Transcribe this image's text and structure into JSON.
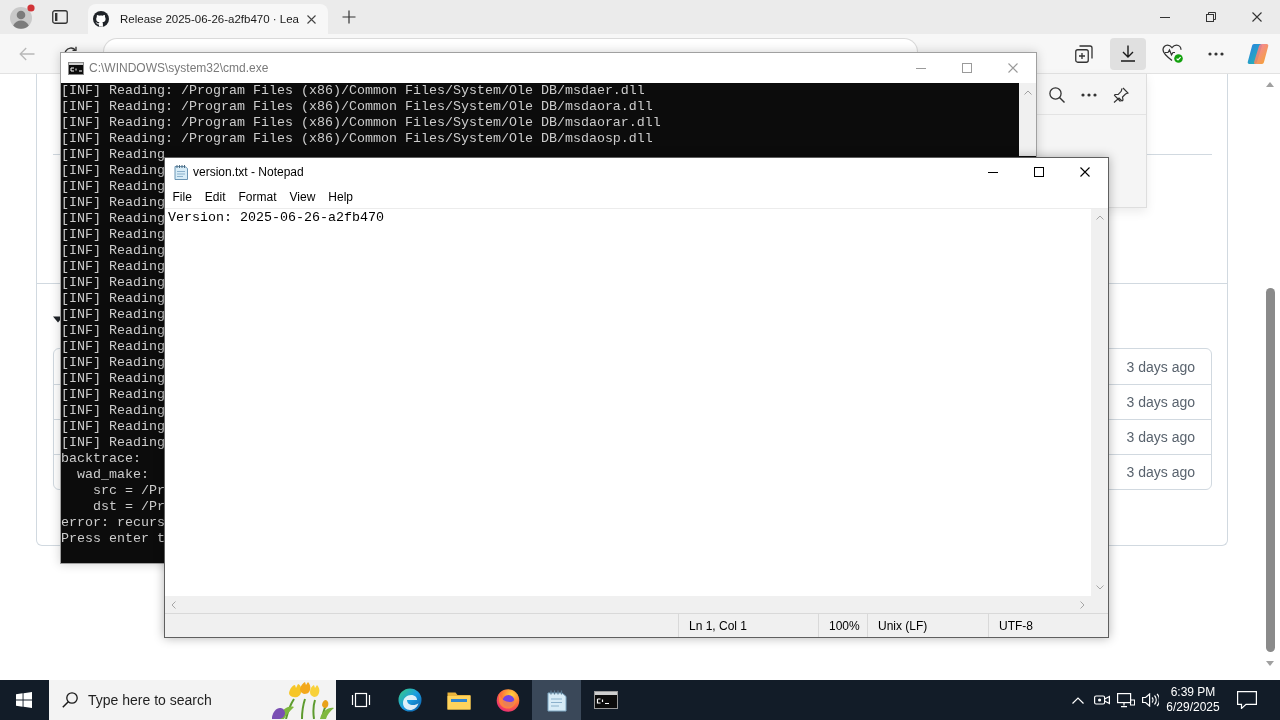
{
  "browser": {
    "tab": {
      "title": "Release 2025-06-26-a2fb470 · Lea",
      "selected": true
    },
    "back_disabled": true,
    "downloads_open": true,
    "page": {
      "assets": {
        "expanded": true,
        "rows": [
          {
            "date": "3 days ago"
          },
          {
            "date": "3 days ago"
          },
          {
            "date": "3 days ago"
          },
          {
            "date": "3 days ago"
          }
        ]
      }
    }
  },
  "cmd_window": {
    "title": "C:\\WINDOWS\\system32\\cmd.exe",
    "active": false,
    "lines": [
      "[INF] Reading: /Program Files (x86)/Common Files/System/Ole DB/msdaer.dll",
      "[INF] Reading: /Program Files (x86)/Common Files/System/Ole DB/msdaora.dll",
      "[INF] Reading: /Program Files (x86)/Common Files/System/Ole DB/msdaorar.dll",
      "[INF] Reading: /Program Files (x86)/Common Files/System/Ole DB/msdaosp.dll",
      "[INF] Reading",
      "[INF] Reading",
      "[INF] Reading",
      "[INF] Reading",
      "[INF] Reading",
      "[INF] Reading",
      "[INF] Reading",
      "[INF] Reading",
      "[INF] Reading",
      "[INF] Reading",
      "[INF] Reading",
      "[INF] Reading",
      "[INF] Reading",
      "[INF] Reading",
      "[INF] Reading",
      "[INF] Reading",
      "[INF] Reading",
      "[INF] Reading",
      "[INF] Reading",
      "backtrace:",
      "  wad_make:",
      "    src = /Pr",
      "    dst = /Pr",
      "error: recurs",
      "Press enter t"
    ]
  },
  "notepad": {
    "title": "version.txt - Notepad",
    "active": true,
    "menu": [
      "File",
      "Edit",
      "Format",
      "View",
      "Help"
    ],
    "text": "Version: 2025-06-26-a2fb470",
    "status": [
      "Ln 1, Col 1",
      "100%",
      "Unix (LF)",
      "UTF-8"
    ]
  },
  "taskbar": {
    "search_placeholder": "Type here to search",
    "apps": [
      {
        "kind": "task_view",
        "selected": false
      },
      {
        "kind": "edge",
        "selected": false
      },
      {
        "kind": "explorer",
        "selected": false
      },
      {
        "kind": "firefox",
        "selected": false
      },
      {
        "kind": "notepad",
        "selected": true
      },
      {
        "kind": "terminal",
        "selected": false
      }
    ],
    "clock": {
      "time": "6:39 PM",
      "date": "6/29/2025"
    }
  }
}
